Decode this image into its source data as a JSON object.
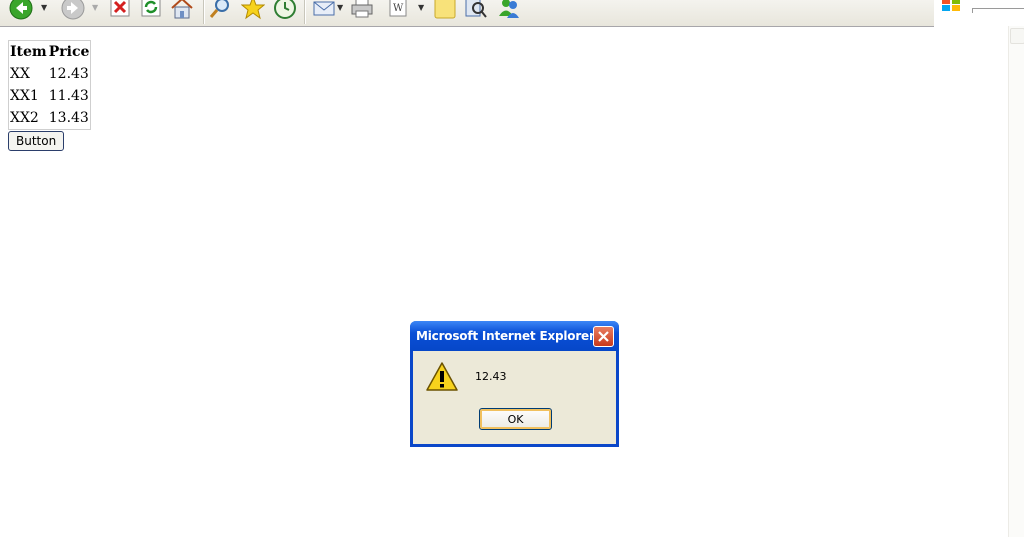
{
  "toolbar": {
    "icons": [
      "back-icon",
      "forward-icon",
      "stop-icon",
      "refresh-icon",
      "home-icon",
      "search-icon",
      "favorites-icon",
      "history-icon",
      "mail-icon",
      "print-icon",
      "edit-icon",
      "discuss-icon",
      "research-icon",
      "messenger-icon"
    ]
  },
  "table": {
    "headers": [
      "Item",
      "Price"
    ],
    "rows": [
      [
        "XX",
        "12.43"
      ],
      [
        "XX1",
        "11.43"
      ],
      [
        "XX2",
        "13.43"
      ]
    ]
  },
  "page_button_label": "Button",
  "dialog": {
    "title": "Microsoft Internet Explorer",
    "message": "12.43",
    "ok_label": "OK",
    "icon": "warning-icon"
  },
  "colors": {
    "titlebar": "#0a4fd6",
    "dialog_bg": "#ece9d8",
    "close_button": "#c8391b"
  }
}
